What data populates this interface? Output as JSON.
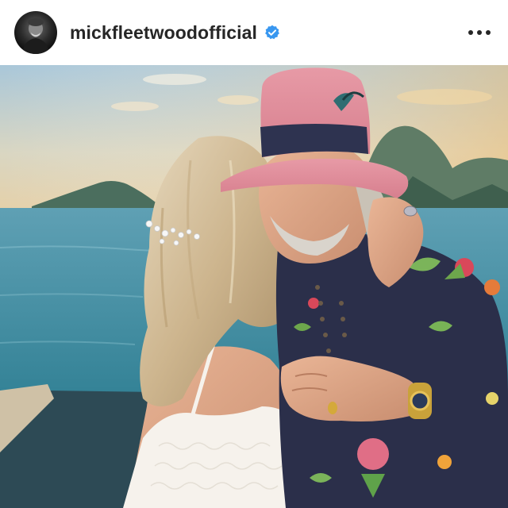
{
  "post": {
    "username": "mickfleetwoodofficial",
    "verified": true,
    "icons": {
      "avatar": "profile-avatar",
      "verified": "verified-badge-icon",
      "more": "more-options-icon"
    },
    "colors": {
      "verified_badge": "#3897f0",
      "username_text": "#262626"
    }
  },
  "photo": {
    "alt": "Couple kissing at sunset on a dock overlooking a lagoon"
  }
}
